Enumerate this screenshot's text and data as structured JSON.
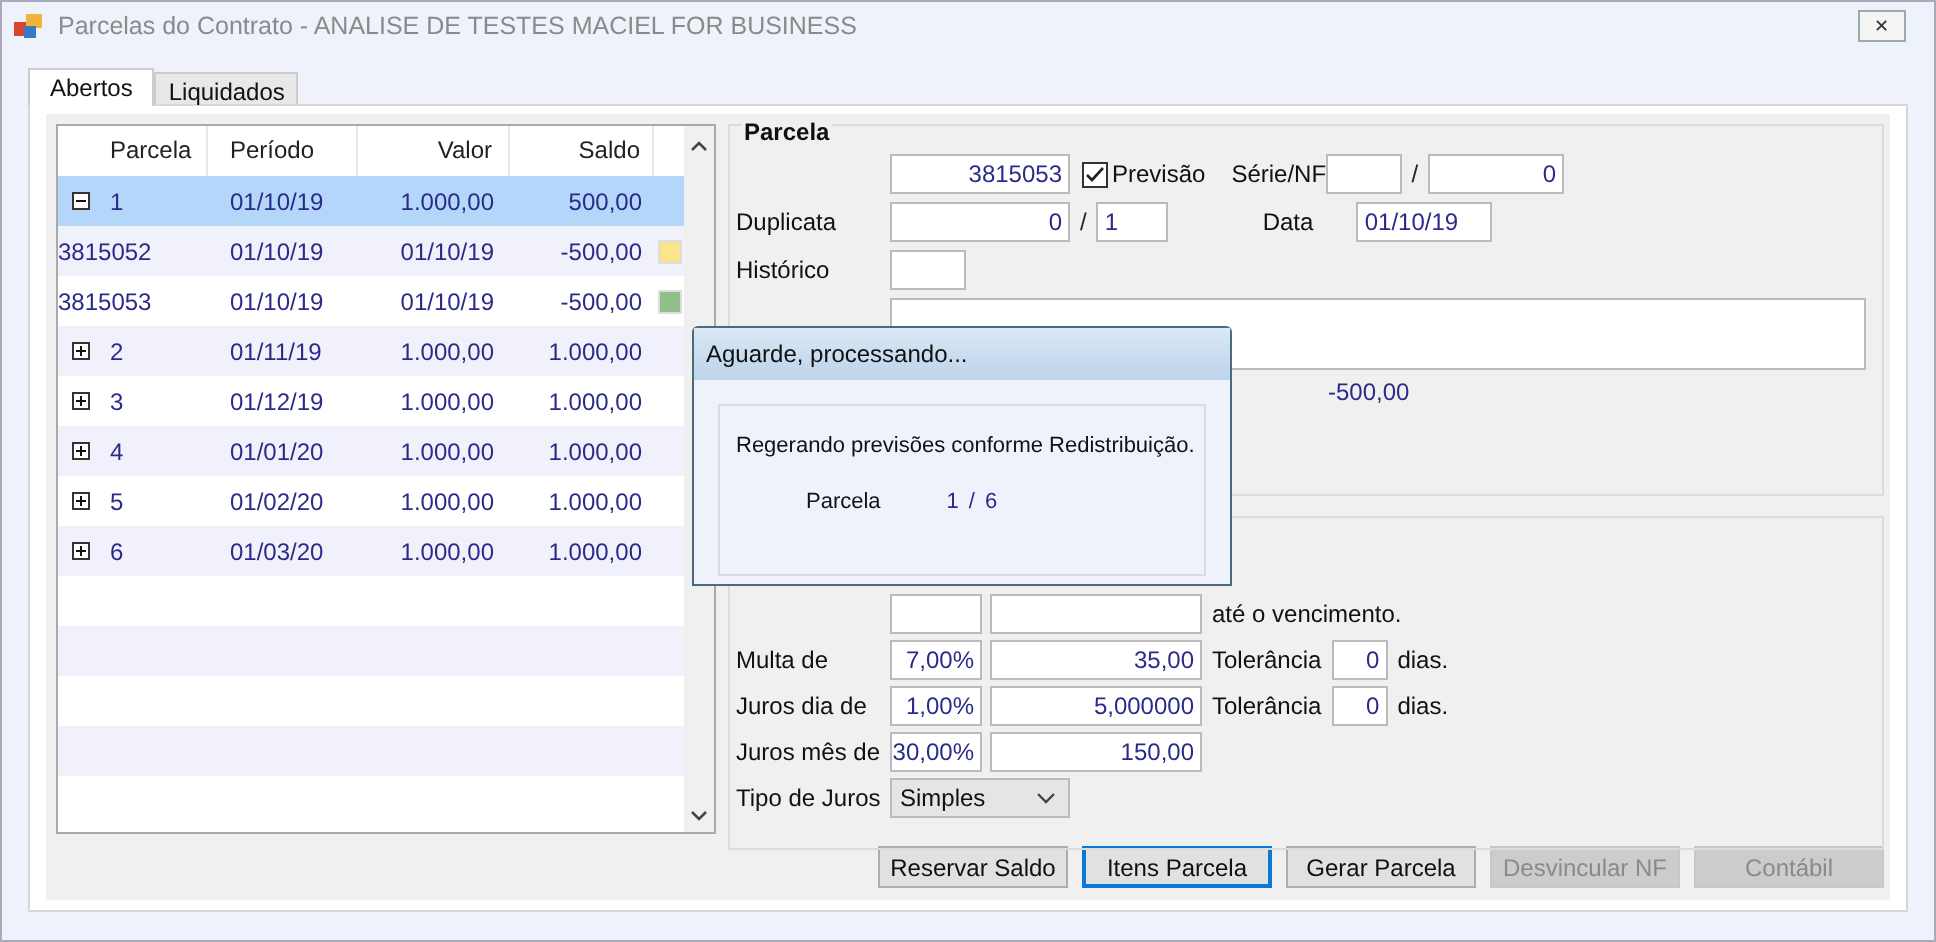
{
  "window": {
    "title": "Parcelas do Contrato - ANALISE DE TESTES MACIEL FOR BUSINESS",
    "close": "✕"
  },
  "tabs": [
    {
      "label": "Abertos",
      "selected": true
    },
    {
      "label": "Liquidados",
      "selected": false
    }
  ],
  "grid": {
    "columns": [
      "Parcela",
      "Período",
      "Valor",
      "Saldo"
    ],
    "rows": [
      {
        "kind": "group",
        "expanded": true,
        "selected": true,
        "cells": [
          "1",
          "01/10/19",
          "1.000,00",
          "500,00"
        ]
      },
      {
        "kind": "item",
        "selected": false,
        "color": "#fbe48a",
        "cells": [
          "3815052",
          "01/10/19",
          "01/10/19",
          "-500,00"
        ]
      },
      {
        "kind": "item",
        "selected": false,
        "color": "#8fbf8a",
        "cells": [
          "3815053",
          "01/10/19",
          "01/10/19",
          "-500,00"
        ]
      },
      {
        "kind": "group",
        "expanded": false,
        "selected": false,
        "cells": [
          "2",
          "01/11/19",
          "1.000,00",
          "1.000,00"
        ]
      },
      {
        "kind": "group",
        "expanded": false,
        "selected": false,
        "cells": [
          "3",
          "01/12/19",
          "1.000,00",
          "1.000,00"
        ]
      },
      {
        "kind": "group",
        "expanded": false,
        "selected": false,
        "cells": [
          "4",
          "01/01/20",
          "1.000,00",
          "1.000,00"
        ]
      },
      {
        "kind": "group",
        "expanded": false,
        "selected": false,
        "cells": [
          "5",
          "01/02/20",
          "1.000,00",
          "1.000,00"
        ]
      },
      {
        "kind": "group",
        "expanded": false,
        "selected": false,
        "cells": [
          "6",
          "01/03/20",
          "1.000,00",
          "1.000,00"
        ]
      }
    ]
  },
  "parcela": {
    "title": "Parcela",
    "number": "3815053",
    "previsao": {
      "label": "Previsão",
      "checked": true
    },
    "serie_label": "Série/NF",
    "serie_sep": "/",
    "nf": "0",
    "duplicata_label": "Duplicata",
    "duplicata": "0",
    "duplicata_sep": "/",
    "duplicata_total": "1",
    "data_label": "Data",
    "data": "01/10/19",
    "historico_label": "Histórico",
    "saldo": "-500,00"
  },
  "encargos": {
    "vencimento": "até o vencimento.",
    "rows": [
      {
        "label": "Multa de",
        "percent": "7,00%",
        "value": "35,00",
        "tolerance_label": "Tolerância",
        "tolerance": "0",
        "unit": "dias."
      },
      {
        "label": "Juros dia de",
        "percent": "1,00%",
        "value": "5,000000",
        "tolerance_label": "Tolerância",
        "tolerance": "0",
        "unit": "dias."
      },
      {
        "label": "Juros mês de",
        "percent": "30,00%",
        "value": "150,00"
      }
    ],
    "tipo": {
      "label": "Tipo de Juros",
      "value": "Simples"
    }
  },
  "buttons": [
    {
      "label": "Reservar Saldo",
      "focused": false,
      "disabled": false
    },
    {
      "label": "Itens Parcela",
      "focused": true,
      "disabled": false
    },
    {
      "label": "Gerar Parcela",
      "focused": false,
      "disabled": false
    },
    {
      "label": "Desvincular NF",
      "focused": false,
      "disabled": true
    },
    {
      "label": "Contábil",
      "focused": false,
      "disabled": true
    }
  ],
  "dialog": {
    "title": "Aguarde, processando...",
    "message": "Regerando previsões conforme Redistribuição.",
    "label": "Parcela",
    "current": "1",
    "sep": "/",
    "total": "6"
  }
}
